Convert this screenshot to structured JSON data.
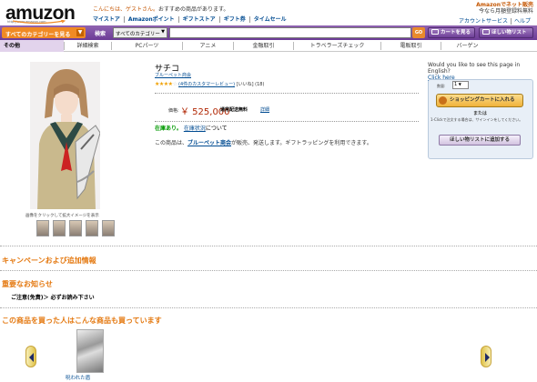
{
  "header": {
    "logo": "amuzon",
    "logo_site": "http://www.amazon.com",
    "greeting_prefix": "こんにちは、ゲストさん。",
    "greeting_suffix": "おすすめの商品があります。",
    "top_nav": [
      "マイストア",
      "Amazonポイント",
      "ギフトストア",
      "ギフト券",
      "タイムセール"
    ],
    "promo_line1": "Amazonでネット販売",
    "promo_line2": "今なら月額登録料無料",
    "help_nav": [
      "アカウントサービス",
      "ヘルプ"
    ]
  },
  "navbar": {
    "category_button": "すべてのカテゴリーを見る",
    "search_label": "検索",
    "search_category": "すべてのカテゴリー",
    "search_value": "",
    "go_label": "GO",
    "cart_button": "カートを見る",
    "wishlist_button": "ほしい物リスト"
  },
  "subnav": [
    "その他",
    "詳細検索",
    "PCパーツ",
    "アニメ",
    "金融取引",
    "トラベラーズチェック",
    "電販取引",
    "バーゲン"
  ],
  "product": {
    "image_caption": "画像をクリックして拡大イメージを表示",
    "title": "サチコ",
    "brand": "ブルーペット商会",
    "stars": "★★★★",
    "stars_empty": "☆",
    "review_link": "(4件のカスタマーレビュー)",
    "review_extra": "[いいね] (18)",
    "price_label": "価格:",
    "price": "￥ 525,000",
    "shipping": "通常配送無料",
    "detail_link": "詳細",
    "stock_status": "在庫あり。",
    "stock_link": "在庫状況",
    "stock_suffix": "について",
    "sold_by_prefix": "この商品は、",
    "sold_by_name": "ブルーペット商会",
    "sold_by_suffix": "が販売、発送します。ギフトラッピングを利用できます。"
  },
  "buybox": {
    "question": "Would you like to see this page in English?",
    "question_link": "Click here",
    "qty_label": "数量:",
    "qty_value": "1",
    "add_to_cart": "ショッピングカートに入れる",
    "or_text": "または",
    "oneclick_note": "1-Clickで注文する場合は、サインインをしてください。",
    "add_to_wishlist": "ほしい物リストに追加する"
  },
  "sections": {
    "campaign": "キャンペーンおよび追加情報",
    "notice": "重要なお知らせ",
    "caution": "ご注意(免責)＞ 必ずお読み下さい",
    "also_bought": "この商品を買った人はこんな商品も買っています"
  },
  "carousel": {
    "item_label": "呪われた盾"
  },
  "colors": {
    "nav_purple": "#6c3b96",
    "accent_orange": "#e47911",
    "price_red": "#b12704",
    "stock_green": "#009900"
  }
}
